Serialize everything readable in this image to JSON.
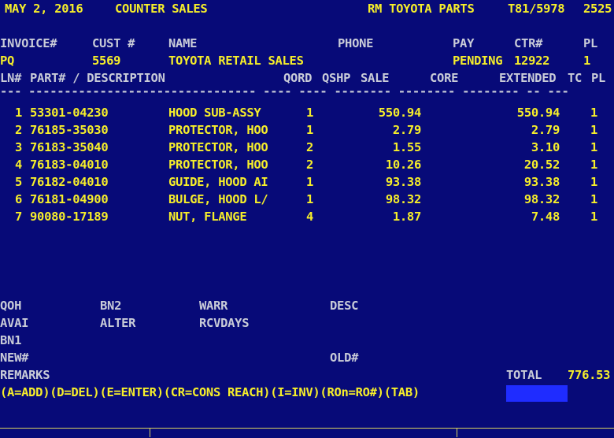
{
  "header": {
    "date": "MAY 2, 2016",
    "screen_title": "COUNTER SALES",
    "app_title": "RM TOYOTA PARTS",
    "terminal": "T81/5978",
    "number": "2525"
  },
  "invoice_header": {
    "labels": {
      "invoice": "INVOICE#",
      "cust": "CUST #",
      "name": "NAME",
      "phone": "PHONE",
      "pay": "PAY",
      "ctr": "CTR#",
      "pl": "PL"
    },
    "values": {
      "invoice": "PQ",
      "cust": "5569",
      "name": "TOYOTA RETAIL SALES",
      "phone": "",
      "pay": "PENDING",
      "ctr": "12922",
      "pl": "1"
    }
  },
  "table": {
    "columns": [
      "LN#",
      "PART# / DESCRIPTION",
      "QORD",
      "QSHP",
      "SALE",
      "CORE",
      "EXTENDED",
      "TC",
      "PL"
    ],
    "rule_text": "--- -------------------------------- ---- ---- -------- -------- -------- -- ---",
    "rows": [
      {
        "ln": "1",
        "part": "53301-04230",
        "desc": "HOOD SUB-ASSY",
        "qord": "1",
        "sale": "550.94",
        "extended": "550.94",
        "pl": "1"
      },
      {
        "ln": "2",
        "part": "76185-35030",
        "desc": "PROTECTOR, HOO",
        "qord": "1",
        "sale": "2.79",
        "extended": "2.79",
        "pl": "1"
      },
      {
        "ln": "3",
        "part": "76183-35040",
        "desc": "PROTECTOR, HOO",
        "qord": "2",
        "sale": "1.55",
        "extended": "3.10",
        "pl": "1"
      },
      {
        "ln": "4",
        "part": "76183-04010",
        "desc": "PROTECTOR, HOO",
        "qord": "2",
        "sale": "10.26",
        "extended": "20.52",
        "pl": "1"
      },
      {
        "ln": "5",
        "part": "76182-04010",
        "desc": "GUIDE, HOOD AI",
        "qord": "1",
        "sale": "93.38",
        "extended": "93.38",
        "pl": "1"
      },
      {
        "ln": "6",
        "part": "76181-04900",
        "desc": "BULGE, HOOD L/",
        "qord": "1",
        "sale": "98.32",
        "extended": "98.32",
        "pl": "1"
      },
      {
        "ln": "7",
        "part": "90080-17189",
        "desc": "NUT, FLANGE",
        "qord": "4",
        "sale": "1.87",
        "extended": "7.48",
        "pl": "1"
      }
    ]
  },
  "info": {
    "qoh": "QOH",
    "bn2": "BN2",
    "warr": "WARR",
    "desc": "DESC",
    "avai": "AVAI",
    "alter": "ALTER",
    "rcvdays": "RCVDAYS",
    "bn1": "BN1",
    "new": "NEW#",
    "old": "OLD#",
    "remarks": "REMARKS",
    "total_label": "TOTAL",
    "total_value": "776.53"
  },
  "command_line": "(A=ADD)(D=DEL)(E=ENTER)(CR=CONS REACH)(I=INV)(ROn=RO#)(TAB)",
  "colors": {
    "background": "#070a78",
    "text": "#f6ee2a",
    "label": "#c9ccd8",
    "cursor": "#1f2cff"
  }
}
